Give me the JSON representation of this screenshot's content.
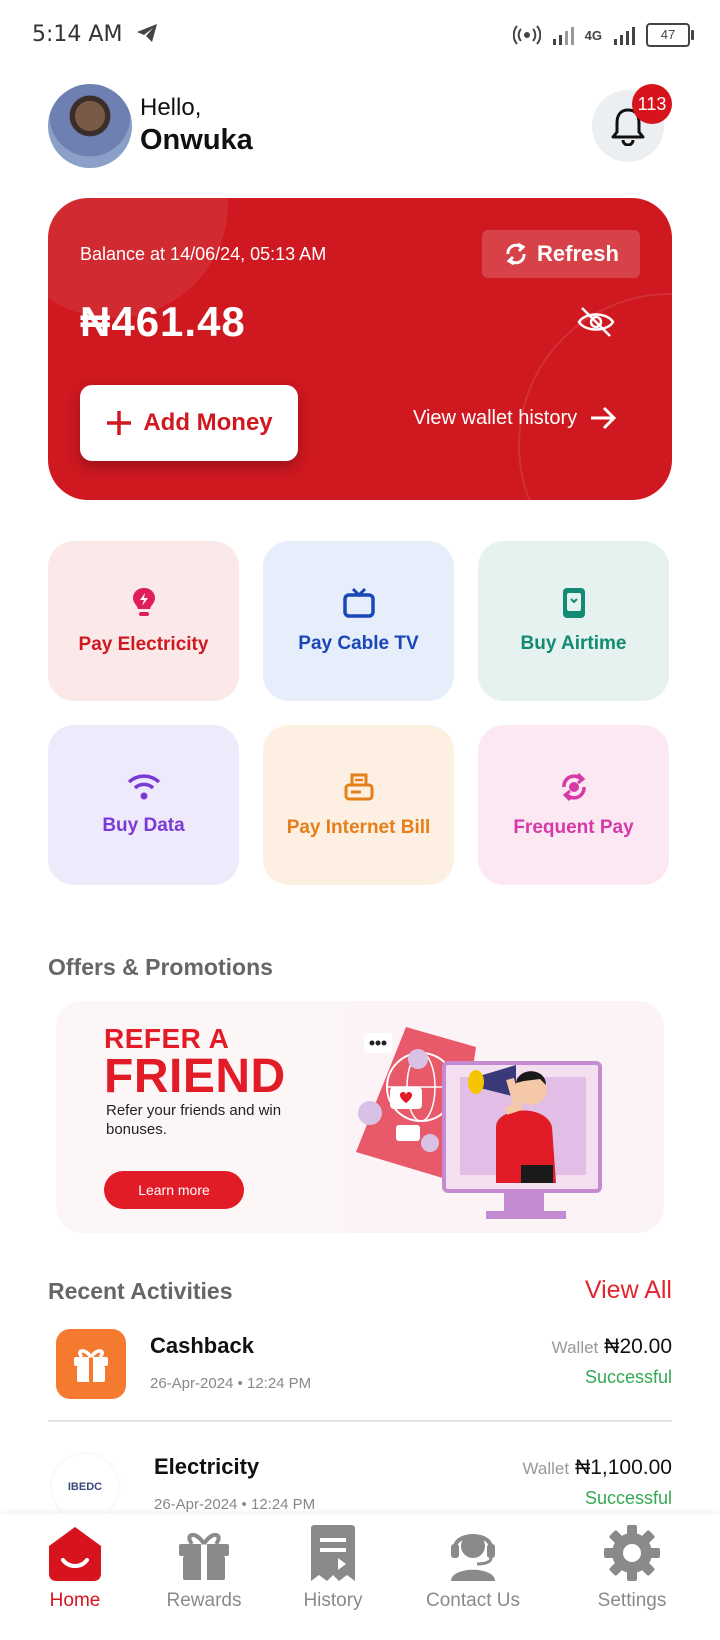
{
  "status_bar": {
    "time": "5:14 AM",
    "network": "4G",
    "battery": "47"
  },
  "header": {
    "greeting": "Hello,",
    "name": "Onwuka",
    "notification_count": "113"
  },
  "wallet": {
    "balance_label": "Balance at 14/06/24, 05:13 AM",
    "refresh_label": "Refresh",
    "balance": "₦461.48",
    "add_money_label": "Add Money",
    "history_label": "View wallet history"
  },
  "services": [
    {
      "label": "Pay Electricity",
      "icon": "bulb-icon",
      "bg": "#fbe8e8",
      "color": "#cf1820"
    },
    {
      "label": "Pay Cable TV",
      "icon": "tv-icon",
      "bg": "#e6edfb",
      "color": "#1a47b8"
    },
    {
      "label": "Buy Airtime",
      "icon": "phone-icon",
      "bg": "#e5f2ef",
      "color": "#138a74"
    },
    {
      "label": "Buy Data",
      "icon": "wifi-icon",
      "bg": "#eeeafc",
      "color": "#7a3ad6"
    },
    {
      "label": "Pay Internet Bill",
      "icon": "router-icon",
      "bg": "#fdf0e3",
      "color": "#e67e1a"
    },
    {
      "label": "Frequent Pay",
      "icon": "repeat-icon",
      "bg": "#fce8f3",
      "color": "#d63aa8"
    }
  ],
  "offers": {
    "title": "Offers & Promotions",
    "promo": {
      "line1": "REFER A",
      "line2": "FRIEND",
      "subtitle": "Refer your friends and win bonuses.",
      "button": "Learn more"
    }
  },
  "activities": {
    "title": "Recent Activities",
    "view_all": "View All",
    "items": [
      {
        "title": "Cashback",
        "date": "26-Apr-2024 • 12:24 PM",
        "source": "Wallet",
        "amount": "₦20.00",
        "status": "Successful",
        "icon": "gift-icon"
      },
      {
        "title": "Electricity",
        "date": "26-Apr-2024 • 12:24 PM",
        "source": "Wallet",
        "amount": "₦1,100.00",
        "status": "Successful",
        "icon": "ibedc-logo",
        "logo_text": "IBEDC"
      }
    ]
  },
  "nav": [
    {
      "label": "Home",
      "icon": "home-icon",
      "active": true
    },
    {
      "label": "Rewards",
      "icon": "gift-icon",
      "active": false
    },
    {
      "label": "History",
      "icon": "receipt-icon",
      "active": false
    },
    {
      "label": "Contact Us",
      "icon": "headset-icon",
      "active": false
    },
    {
      "label": "Settings",
      "icon": "gear-icon",
      "active": false
    }
  ],
  "colors": {
    "brand": "#cf1820",
    "success": "#34a853"
  }
}
